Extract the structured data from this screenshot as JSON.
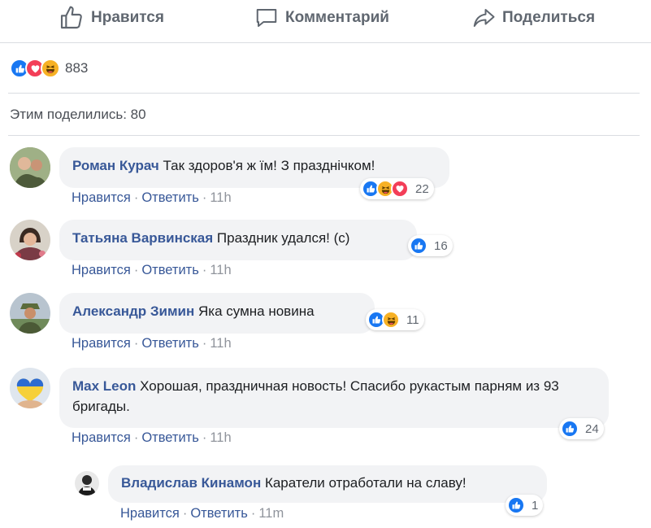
{
  "actions": {
    "like": "Нравится",
    "comment": "Комментарий",
    "share": "Поделиться"
  },
  "summary": {
    "reactions": [
      "like",
      "love",
      "haha"
    ],
    "count": "883"
  },
  "shared": "Этим поделились: 80",
  "comments": [
    {
      "author": "Роман Курач",
      "text": "Так здоров'я ж їм! З празднічком!",
      "like": "Нравится",
      "reply": "Ответить",
      "time": "11h",
      "reactions": [
        "like",
        "haha",
        "love"
      ],
      "reaction_count": "22"
    },
    {
      "author": "Татьяна Варвинская",
      "text": "Праздник удался! (с)",
      "like": "Нравится",
      "reply": "Ответить",
      "time": "11h",
      "reactions": [
        "like"
      ],
      "reaction_count": "16"
    },
    {
      "author": "Александр Зимин",
      "text": "Яка сумна новина",
      "like": "Нравится",
      "reply": "Ответить",
      "time": "11h",
      "reactions": [
        "like",
        "haha"
      ],
      "reaction_count": "11"
    },
    {
      "author": "Max Leon",
      "text": "Хорошая, праздничная новость! Спасибо рукастым парням из 93 бригады.",
      "like": "Нравится",
      "reply": "Ответить",
      "time": "11h",
      "reactions": [
        "like"
      ],
      "reaction_count": "24"
    },
    {
      "author": "Владислав Кинамон",
      "text": "Каратели отработали на славу!",
      "like": "Нравится",
      "reply": "Ответить",
      "time": "11m",
      "reactions": [
        "like"
      ],
      "reaction_count": "1"
    }
  ],
  "colors": {
    "link": "#385898",
    "like_blue": "#1877f2",
    "love_red": "#f33e58",
    "haha_yellow": "#f7b125",
    "bubble": "#f2f3f5"
  }
}
